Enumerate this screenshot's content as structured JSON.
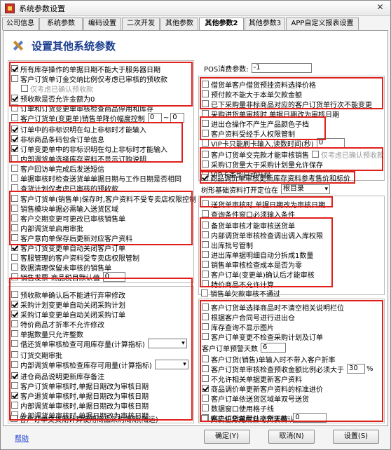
{
  "window": {
    "title": "系统参数设置",
    "close_glyph": "✕"
  },
  "tabs": [
    "公司信息",
    "系统参数",
    "编码设置",
    "二次开发",
    "其他参数",
    "其他参数2",
    "其他参数3",
    "APP自定义报表设置"
  ],
  "header": {
    "title": "设置其他系统参数",
    "icon": "tools-icon"
  },
  "left_group1": [
    {
      "label": "所有库存操作的单据日期不能大于服务器日期",
      "checked": true
    },
    {
      "label": "客户订货单订金交纳比例仅考虑已审核的预收款",
      "checked": false
    },
    {
      "label": "仅考虑已确认预收款",
      "checked": false,
      "disabled": true
    },
    {
      "label": "预收款是否允许金额为0",
      "checked": true
    },
    {
      "label": "订单和订货变更单审核检查商品停用和库存",
      "checked": false
    },
    {
      "label": "客户订货单(变更单)销售单降价幅度控制",
      "checked": false,
      "input": "0",
      "tilde": "~",
      "input2": "0"
    },
    {
      "label": "订单中的非标识明在勾上非标时才能输入",
      "checked": true
    },
    {
      "label": "非标商品条码包含订单信息",
      "checked": true
    },
    {
      "label": "订单变更单中的非标识明在勾上非标时才能输入",
      "checked": true
    },
    {
      "label": "内部调货单选择库存资料不显示订购说明",
      "checked": false
    },
    {
      "label": "客户回访单完成后发送短信",
      "checked": false
    },
    {
      "label": "单据审核时检查送货单单据日期与工作日期是否相同",
      "checked": false
    },
    {
      "label": "查货计划仅考虑已审核的预收款",
      "checked": false
    },
    {
      "label": "客户订货单(销售单)保存时,客户资料不受专卖店权限控制",
      "checked": false
    },
    {
      "label": "销售模块单据必需输入送货区域",
      "checked": false
    },
    {
      "label": "客户交期变更可更改已审核销售单",
      "checked": false
    },
    {
      "label": "内部调货单启用审批",
      "checked": false
    },
    {
      "label": "客户意向单保存后更新对应客户资料",
      "checked": false
    },
    {
      "label": "客户订货变更单自动关闭客户订单",
      "checked": true
    },
    {
      "label": "客服管理的客户资料受专卖店权限管制",
      "checked": false
    },
    {
      "label": "数据清理保留未审核的销售单",
      "checked": false
    },
    {
      "label": "销售发票-商品税目默认值",
      "checked": false,
      "input": "0"
    }
  ],
  "left_group2": [
    {
      "label": "预收款单确认后不能进行弃审修改",
      "checked": false
    },
    {
      "label": "采购计划变更单自动关闭采购计划",
      "checked": true
    },
    {
      "label": "采购订单变更单自动关闭采购订单",
      "checked": true
    },
    {
      "label": "特价商品才折率不允许修改",
      "checked": false
    },
    {
      "label": "单据数量只允许整数",
      "checked": false
    },
    {
      "label": "借还货单审核检查可用库存量(计算指标)",
      "checked": false,
      "select": ""
    },
    {
      "label": "订货交期审批",
      "checked": false
    },
    {
      "label": "内部调货单审核检查库存可用量(计算指标)",
      "checked": false,
      "select": ""
    },
    {
      "label": "进仓商品说明更新库存备注",
      "checked": true
    },
    {
      "label": "客户订货单审核时,单据日期改为审核日期",
      "checked": false
    },
    {
      "label": "客户退货单审核时,单据日期改为审核日期",
      "checked": true
    },
    {
      "label": "内部调货单审核时,单据日期改为审核日期",
      "checked": false
    },
    {
      "label": "外部调货单审核时,单据日期改为审核日期",
      "checked": false
    },
    {
      "label": "客户订单交货期计算使用商品采购周期(陆运)",
      "checked": false
    }
  ],
  "pos": {
    "label": "POS消费参数:",
    "value": "-1"
  },
  "right_group1": [
    {
      "label": "借货单客户借货预挂资料选择价格",
      "checked": false
    },
    {
      "label": "预付款不能大于本单欠款金额",
      "checked": false
    },
    {
      "label": "已下采购量非标商品对应的客户订货单行次不能变更",
      "checked": false
    },
    {
      "label": "采购进货单审核时,单据日期改为审核日期",
      "checked": false
    },
    {
      "label": "进出仓操作不产生产品颜色子档",
      "checked": false
    },
    {
      "label": "客户资料受经手人权限管制",
      "checked": false
    },
    {
      "label": "VIP卡只能刷卡输入,读数时间(秒)",
      "checked": false,
      "input": "0"
    },
    {
      "label": "客户订货单交完款才能审核销售",
      "checked": false,
      "extra": "仅考虑已确认预收款"
    },
    {
      "label": "采购订货量大于采购计划量允许保存",
      "checked": false
    },
    {
      "label": "VIP卡类型自动升级",
      "checked": false
    },
    {
      "label": "商品调价单审核更新库存资料参考售价和标价",
      "checked": true
    }
  ],
  "tree": {
    "label": "树形基础资料打开定位在",
    "select": "根目录"
  },
  "right_group2": [
    {
      "label": "送货单审核时,单据日期改为审核日期",
      "checked": false
    },
    {
      "label": "查询条件窗口必须输入条件",
      "checked": false
    },
    {
      "label": "备货单审核才能审核送货单",
      "checked": false
    },
    {
      "label": "内部调货单审核检查调出调入库权限",
      "checked": false
    },
    {
      "label": "出库批号管制",
      "checked": false
    },
    {
      "label": "进出库单据明细自动分拆成1数量",
      "checked": false
    },
    {
      "label": "销售单审核检查成本是否为零",
      "checked": false
    },
    {
      "label": "客户订单(变更单)确认后才能审核",
      "checked": false
    },
    {
      "label": "特价商品不允许计算",
      "checked": false
    },
    {
      "label": "销售单欠款审核不通过",
      "checked": false
    }
  ],
  "right_group3": [
    {
      "label": "客户订货单选择商品时不清空相关说明栏位",
      "checked": false
    },
    {
      "label": "根据客户合同号进行进出仓",
      "checked": false
    },
    {
      "label": "库存查询不显示图片",
      "checked": false
    },
    {
      "label": "客户订单变更不检查采购计划及订单",
      "checked": false
    },
    {
      "label": "客户订单预警天数",
      "input": "6",
      "nocheck": true
    },
    {
      "label": "客户订货(销售)单输入时不带入客户折率",
      "checked": false
    },
    {
      "label": "客户订货单审核检查预收金额比例必须大于",
      "checked": false,
      "input": "30",
      "unit": "%"
    },
    {
      "label": "不允许相关单据更新客户资料",
      "checked": false
    },
    {
      "label": "商品调价单更新客户资料的标准进价",
      "checked": true
    },
    {
      "label": "客户订单依送货区域单双号送货",
      "checked": false
    },
    {
      "label": "数据窗口使用格子线",
      "checked": false
    },
    {
      "label": "客户订货单默认交货天数:",
      "checked": false,
      "input": "0"
    },
    {
      "label": "安装任务完成自动安装确认",
      "checked": false
    }
  ],
  "footer": {
    "help": "帮助",
    "ok": "确定(Y)",
    "cancel": "取消(N)",
    "settings": "设置(S)"
  }
}
